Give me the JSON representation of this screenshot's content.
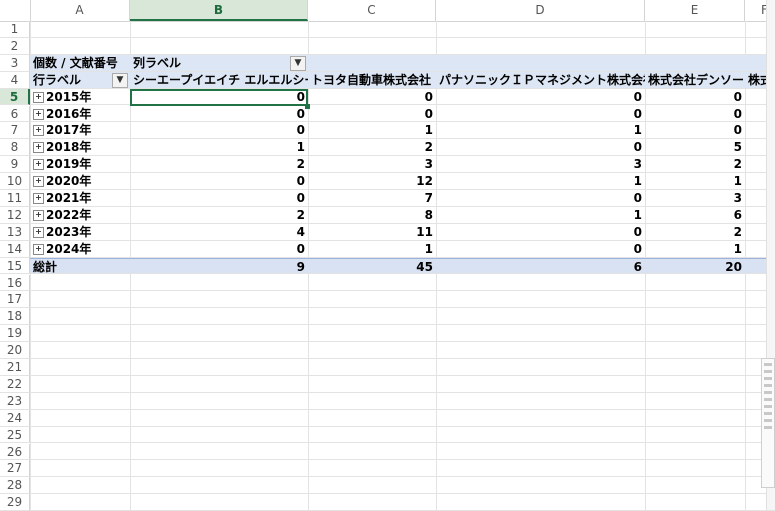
{
  "columns": [
    "A",
    "B",
    "C",
    "D",
    "E",
    "F"
  ],
  "selected_column": "B",
  "rows": [
    "1",
    "2",
    "3",
    "4",
    "5",
    "6",
    "7",
    "8",
    "9",
    "10",
    "11",
    "12",
    "13",
    "14",
    "15",
    "16",
    "17",
    "18",
    "19",
    "20",
    "21",
    "22",
    "23",
    "24",
    "25",
    "26",
    "27",
    "28",
    "29"
  ],
  "selected_row": "5",
  "pivot": {
    "value_field": "個数 / 文献番号",
    "column_labels": "列ラベル",
    "row_labels": "行ラベル",
    "filter_icon": "filter-dropdown-icon",
    "companies": [
      "シーエープイエイチ エルエルシー",
      "トヨタ自動車株式会社",
      "パナソニックＩＰマネジメント株式会社",
      "株式会社デンソー",
      "株式"
    ],
    "data_rows": [
      {
        "label": "2015年",
        "values": [
          "0",
          "0",
          "0",
          "0"
        ]
      },
      {
        "label": "2016年",
        "values": [
          "0",
          "0",
          "0",
          "0"
        ]
      },
      {
        "label": "2017年",
        "values": [
          "0",
          "1",
          "1",
          "0"
        ]
      },
      {
        "label": "2018年",
        "values": [
          "1",
          "2",
          "0",
          "5"
        ]
      },
      {
        "label": "2019年",
        "values": [
          "2",
          "3",
          "3",
          "2"
        ]
      },
      {
        "label": "2020年",
        "values": [
          "0",
          "12",
          "1",
          "1"
        ]
      },
      {
        "label": "2021年",
        "values": [
          "0",
          "7",
          "0",
          "3"
        ]
      },
      {
        "label": "2022年",
        "values": [
          "2",
          "8",
          "1",
          "6"
        ]
      },
      {
        "label": "2023年",
        "values": [
          "4",
          "11",
          "0",
          "2"
        ]
      },
      {
        "label": "2024年",
        "values": [
          "0",
          "1",
          "0",
          "1"
        ]
      }
    ],
    "total_label": "総計",
    "totals": [
      "9",
      "45",
      "6",
      "20"
    ]
  },
  "colors": {
    "accent": "#217346",
    "pivot_header": "#dde6f4",
    "pivot_total": "#d9e2f3"
  }
}
